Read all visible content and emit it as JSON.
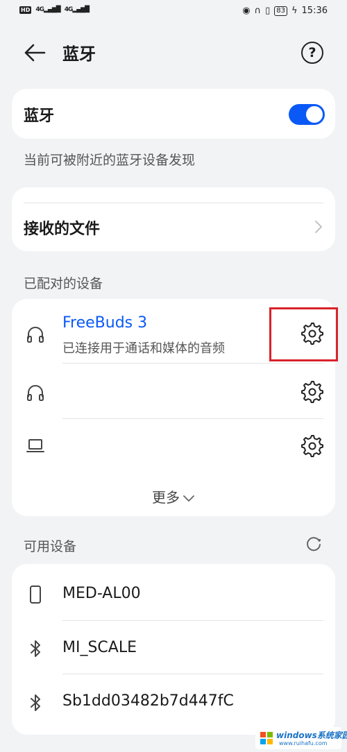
{
  "status_bar": {
    "hd": "HD",
    "signal_1": "4G",
    "signal_2": "4G",
    "battery": "83",
    "time": "15:36"
  },
  "header": {
    "title": "蓝牙"
  },
  "bluetooth": {
    "label": "蓝牙",
    "enabled": true,
    "visibility_hint": "当前可被附近的蓝牙设备发现"
  },
  "received_files": {
    "label": "接收的文件"
  },
  "paired": {
    "section_label": "已配对的设备",
    "devices": [
      {
        "name": "FreeBuds 3",
        "subtitle": "已连接用于通话和媒体的音频",
        "icon": "headphones-icon"
      },
      {
        "name": "",
        "subtitle": "",
        "icon": "headphones-icon"
      },
      {
        "name": "",
        "subtitle": "",
        "icon": "laptop-icon"
      }
    ],
    "more_label": "更多"
  },
  "available": {
    "section_label": "可用设备",
    "devices": [
      {
        "name": "MED-AL00",
        "icon": "phone-icon"
      },
      {
        "name": "MI_SCALE",
        "icon": "bluetooth-icon"
      },
      {
        "name": "Sb1dd03482b7d447fC",
        "icon": "bluetooth-icon"
      }
    ]
  },
  "watermark": {
    "brand": "windows系统家园",
    "url": "www.ruihafu.com"
  },
  "colors": {
    "accent": "#0a59f7",
    "highlight": "#d9222a"
  }
}
